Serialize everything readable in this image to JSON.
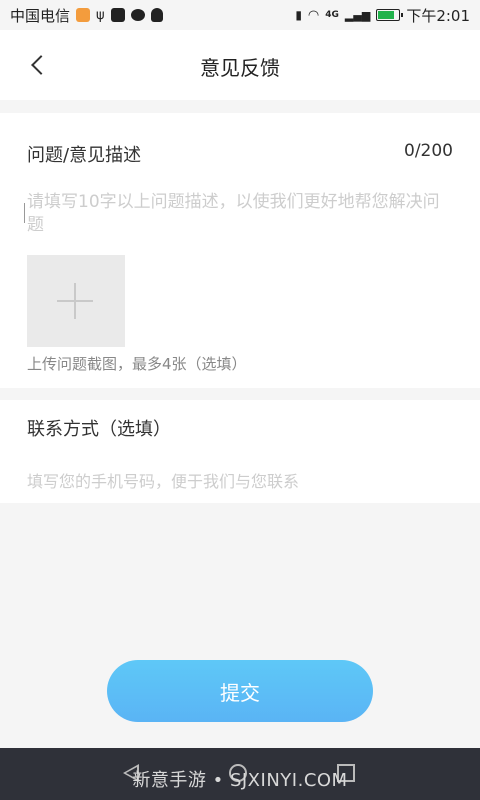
{
  "status_bar": {
    "carrier": "中国电信",
    "signal": "4G",
    "time": "下午2:01"
  },
  "header": {
    "title": "意见反馈"
  },
  "feedback": {
    "label": "问题/意见描述",
    "counter": "0/200",
    "placeholder": "请填写10字以上问题描述，以使我们更好地帮您解决问题",
    "upload_hint": "上传问题截图，最多4张（选填）"
  },
  "contact": {
    "label": "联系方式（选填）",
    "placeholder": "填写您的手机号码，便于我们与您联系"
  },
  "submit": {
    "label": "提交"
  },
  "watermark": {
    "text": "新意手游 • SJXINYI.COM"
  },
  "colors": {
    "accent": "#5ab4f5",
    "background": "#f5f5f5",
    "placeholder": "#cdcdcd"
  }
}
